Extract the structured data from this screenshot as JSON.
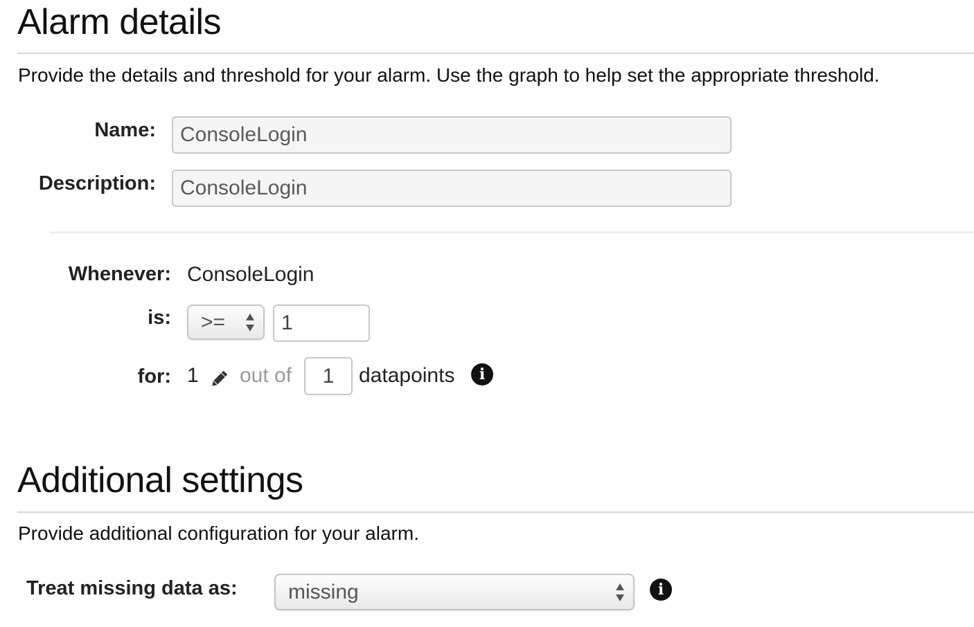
{
  "alarm_details": {
    "title": "Alarm details",
    "description": "Provide the details and threshold for your alarm. Use the graph to help set the appropriate threshold.",
    "name_label": "Name:",
    "name_value": "ConsoleLogin",
    "description_label": "Description:",
    "description_value": "ConsoleLogin",
    "whenever_label": "Whenever:",
    "whenever_value": "ConsoleLogin",
    "is_label": "is:",
    "operator_value": ">=",
    "threshold_value": "1",
    "for_label": "for:",
    "datapoints_to_alarm": "1",
    "out_of_text": "out of",
    "evaluation_periods": "1",
    "datapoints_text": "datapoints",
    "info_icon_glyph": "i"
  },
  "additional_settings": {
    "title": "Additional settings",
    "description": "Provide additional configuration for your alarm.",
    "missing_data_label": "Treat missing data as:",
    "missing_data_value": "missing",
    "info_icon_glyph": "i"
  },
  "icons": {
    "edit": "pencil-icon",
    "info": "info-icon",
    "select_arrows": "up-down-arrows-icon"
  }
}
